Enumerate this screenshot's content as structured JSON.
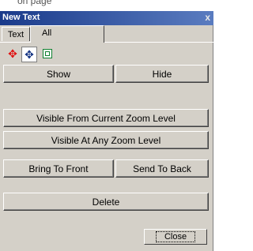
{
  "page": {
    "top_text": "on page"
  },
  "window": {
    "title": "New Text",
    "close_glyph": "x"
  },
  "tabs": [
    {
      "label": "Text",
      "active": false
    },
    {
      "label": "All",
      "active": true
    }
  ],
  "toolbar": {
    "icons": [
      {
        "name": "move-icon",
        "glyph": "✥",
        "color": "#e01010"
      },
      {
        "name": "pan-icon",
        "glyph": "✥",
        "color": "#103080"
      },
      {
        "name": "frame-icon",
        "glyph": "",
        "color": "#108030"
      }
    ]
  },
  "buttons": {
    "show": "Show",
    "hide": "Hide",
    "visible_current_zoom": "Visible From Current Zoom Level",
    "visible_any_zoom": "Visible At Any Zoom Level",
    "bring_to_front": "Bring To Front",
    "send_to_back": "Send To Back",
    "delete": "Delete",
    "close": "Close"
  }
}
